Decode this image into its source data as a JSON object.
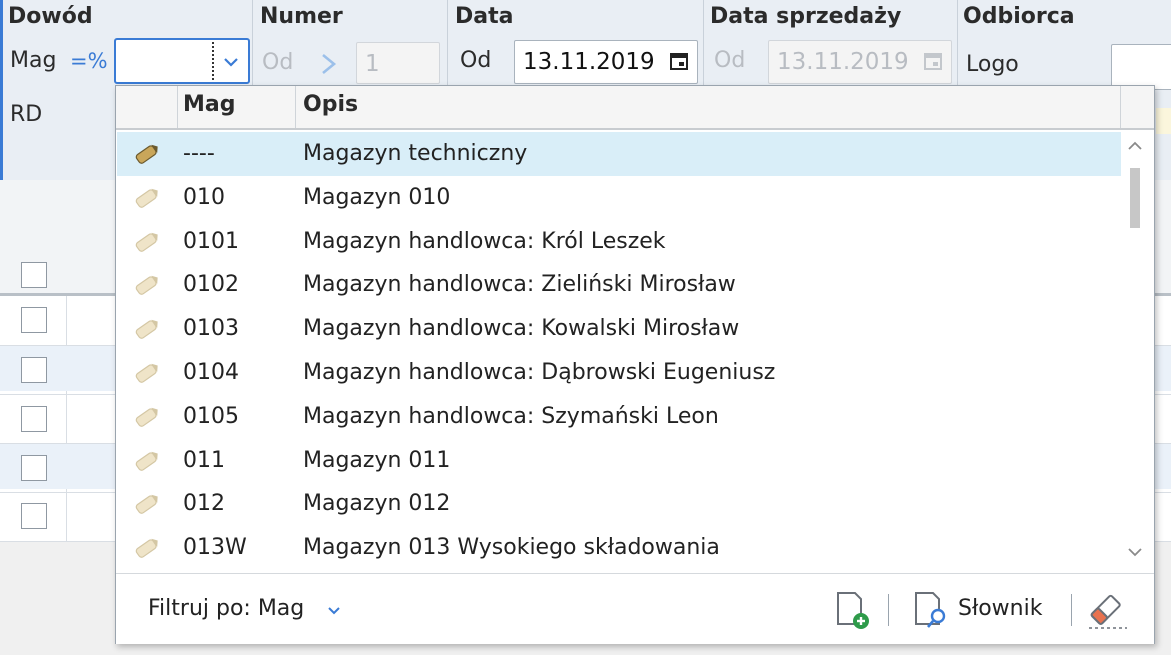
{
  "header": {
    "dowod": {
      "title": "Dowód",
      "mag_label": "Mag",
      "mag_op": "=%",
      "mag_value": "",
      "rd_label": "RD"
    },
    "numer": {
      "title": "Numer",
      "od_label": "Od",
      "value": "1"
    },
    "data": {
      "title": "Data",
      "od_label": "Od",
      "value": "13.11.2019"
    },
    "data_sprzedazy": {
      "title": "Data sprzedaży",
      "od_label": "Od",
      "value": "13.11.2019"
    },
    "odbiorca": {
      "title": "Odbiorca",
      "logo_label": "Logo"
    }
  },
  "dropdown": {
    "columns": [
      "Mag",
      "Opis"
    ],
    "rows": [
      {
        "code": "----",
        "desc": "Magazyn techniczny",
        "selected": true
      },
      {
        "code": "010",
        "desc": "Magazyn 010"
      },
      {
        "code": "0101",
        "desc": "Magazyn handlowca: Król Leszek"
      },
      {
        "code": "0102",
        "desc": "Magazyn handlowca: Zieliński Mirosław"
      },
      {
        "code": "0103",
        "desc": "Magazyn handlowca: Kowalski Mirosław"
      },
      {
        "code": "0104",
        "desc": "Magazyn handlowca: Dąbrowski Eugeniusz"
      },
      {
        "code": "0105",
        "desc": "Magazyn handlowca: Szymański Leon"
      },
      {
        "code": "011",
        "desc": "Magazyn 011"
      },
      {
        "code": "012",
        "desc": "Magazyn 012"
      },
      {
        "code": "013W",
        "desc": "Magazyn 013 Wysokiego składowania"
      }
    ],
    "footer": {
      "filter_label": "Filtruj po: Mag",
      "dictionary_label": "Słownik"
    }
  },
  "colors": {
    "accent": "#3a7bd5",
    "selected_row": "#d9eef8",
    "header_bg": "#e9eef4"
  }
}
